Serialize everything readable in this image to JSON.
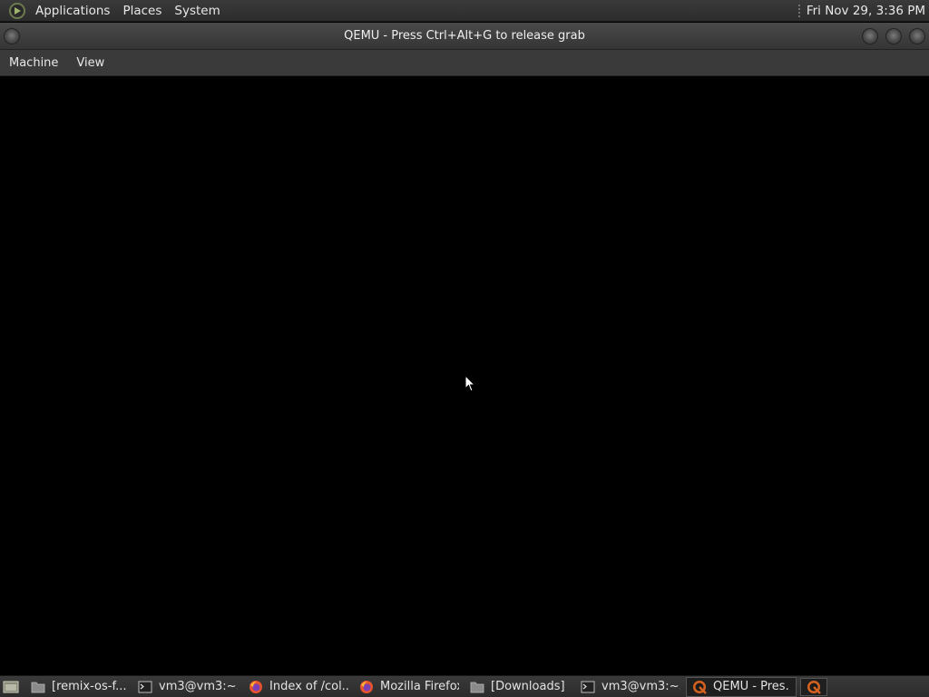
{
  "top_panel": {
    "menus": [
      "Applications",
      "Places",
      "System"
    ],
    "clock": "Fri Nov 29,  3:36 PM"
  },
  "window": {
    "title": "QEMU - Press Ctrl+Alt+G to release grab",
    "menubar": [
      "Machine",
      "View"
    ]
  },
  "taskbar": {
    "tasks": [
      {
        "label": "[remix-os-f...",
        "icon": "folder-icon"
      },
      {
        "label": "vm3@vm3:~...",
        "icon": "terminal-icon"
      },
      {
        "label": "Index of /col...",
        "icon": "firefox-icon"
      },
      {
        "label": "Mozilla Firefox",
        "icon": "firefox-icon"
      },
      {
        "label": "[Downloads]",
        "icon": "folder-icon"
      },
      {
        "label": "vm3@vm3:~...",
        "icon": "terminal-icon"
      },
      {
        "label": "QEMU - Pres...",
        "icon": "qemu-icon",
        "active": true
      }
    ]
  }
}
